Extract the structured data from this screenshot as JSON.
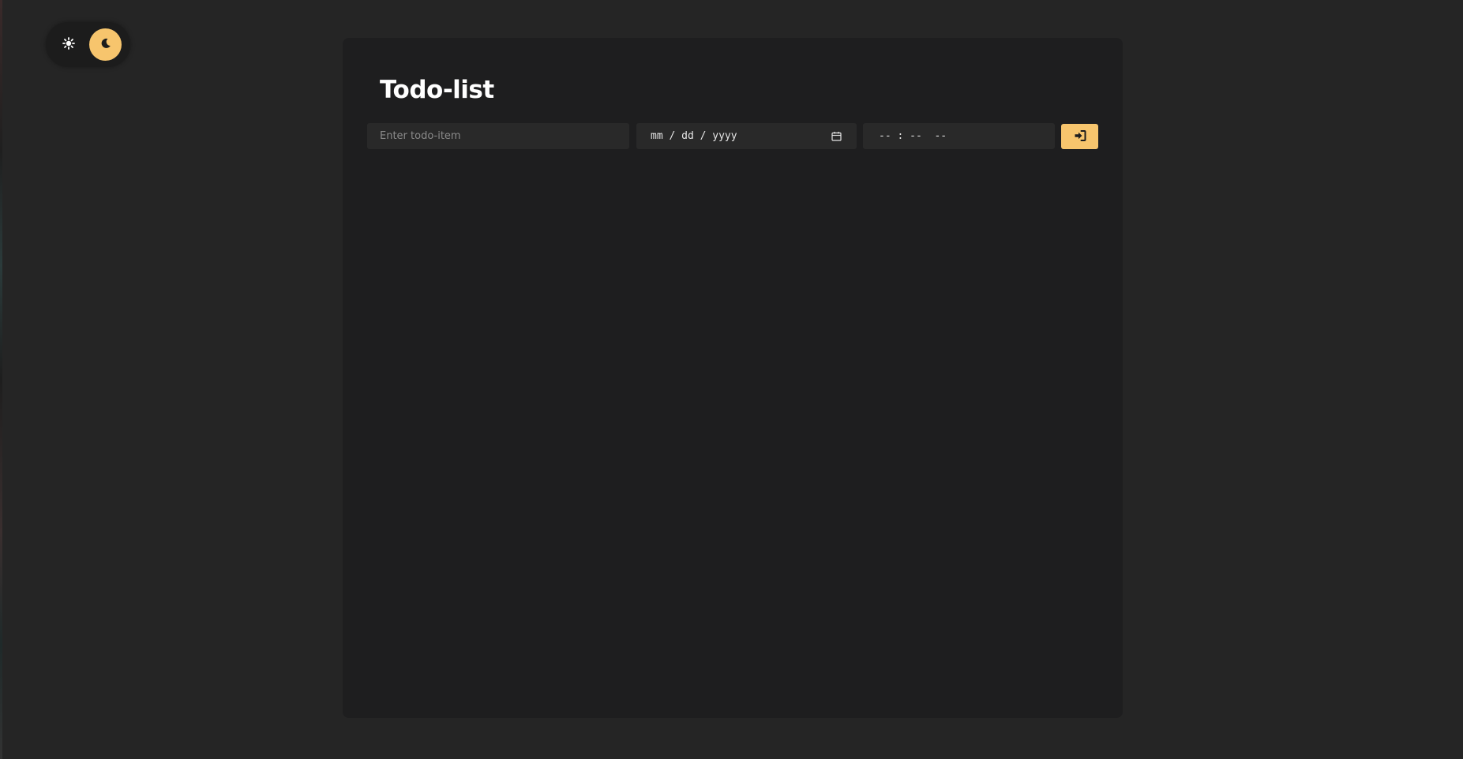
{
  "theme_toggle": {
    "light_icon": "sun-icon",
    "dark_icon": "moon-icon",
    "active": "dark",
    "accent_color": "#f7c56d"
  },
  "app": {
    "title": "Todo-list"
  },
  "form": {
    "todo_placeholder": "Enter todo-item",
    "todo_value": "",
    "date_placeholder": "mm / dd / yyyy",
    "date_icon": "calendar-icon",
    "time_placeholder": "-- : --  --",
    "submit_icon": "sign-in-icon"
  },
  "todos": [],
  "colors": {
    "background": "#252525",
    "card": "#1e1e1f",
    "input": "#292929",
    "accent": "#f7c56d"
  }
}
